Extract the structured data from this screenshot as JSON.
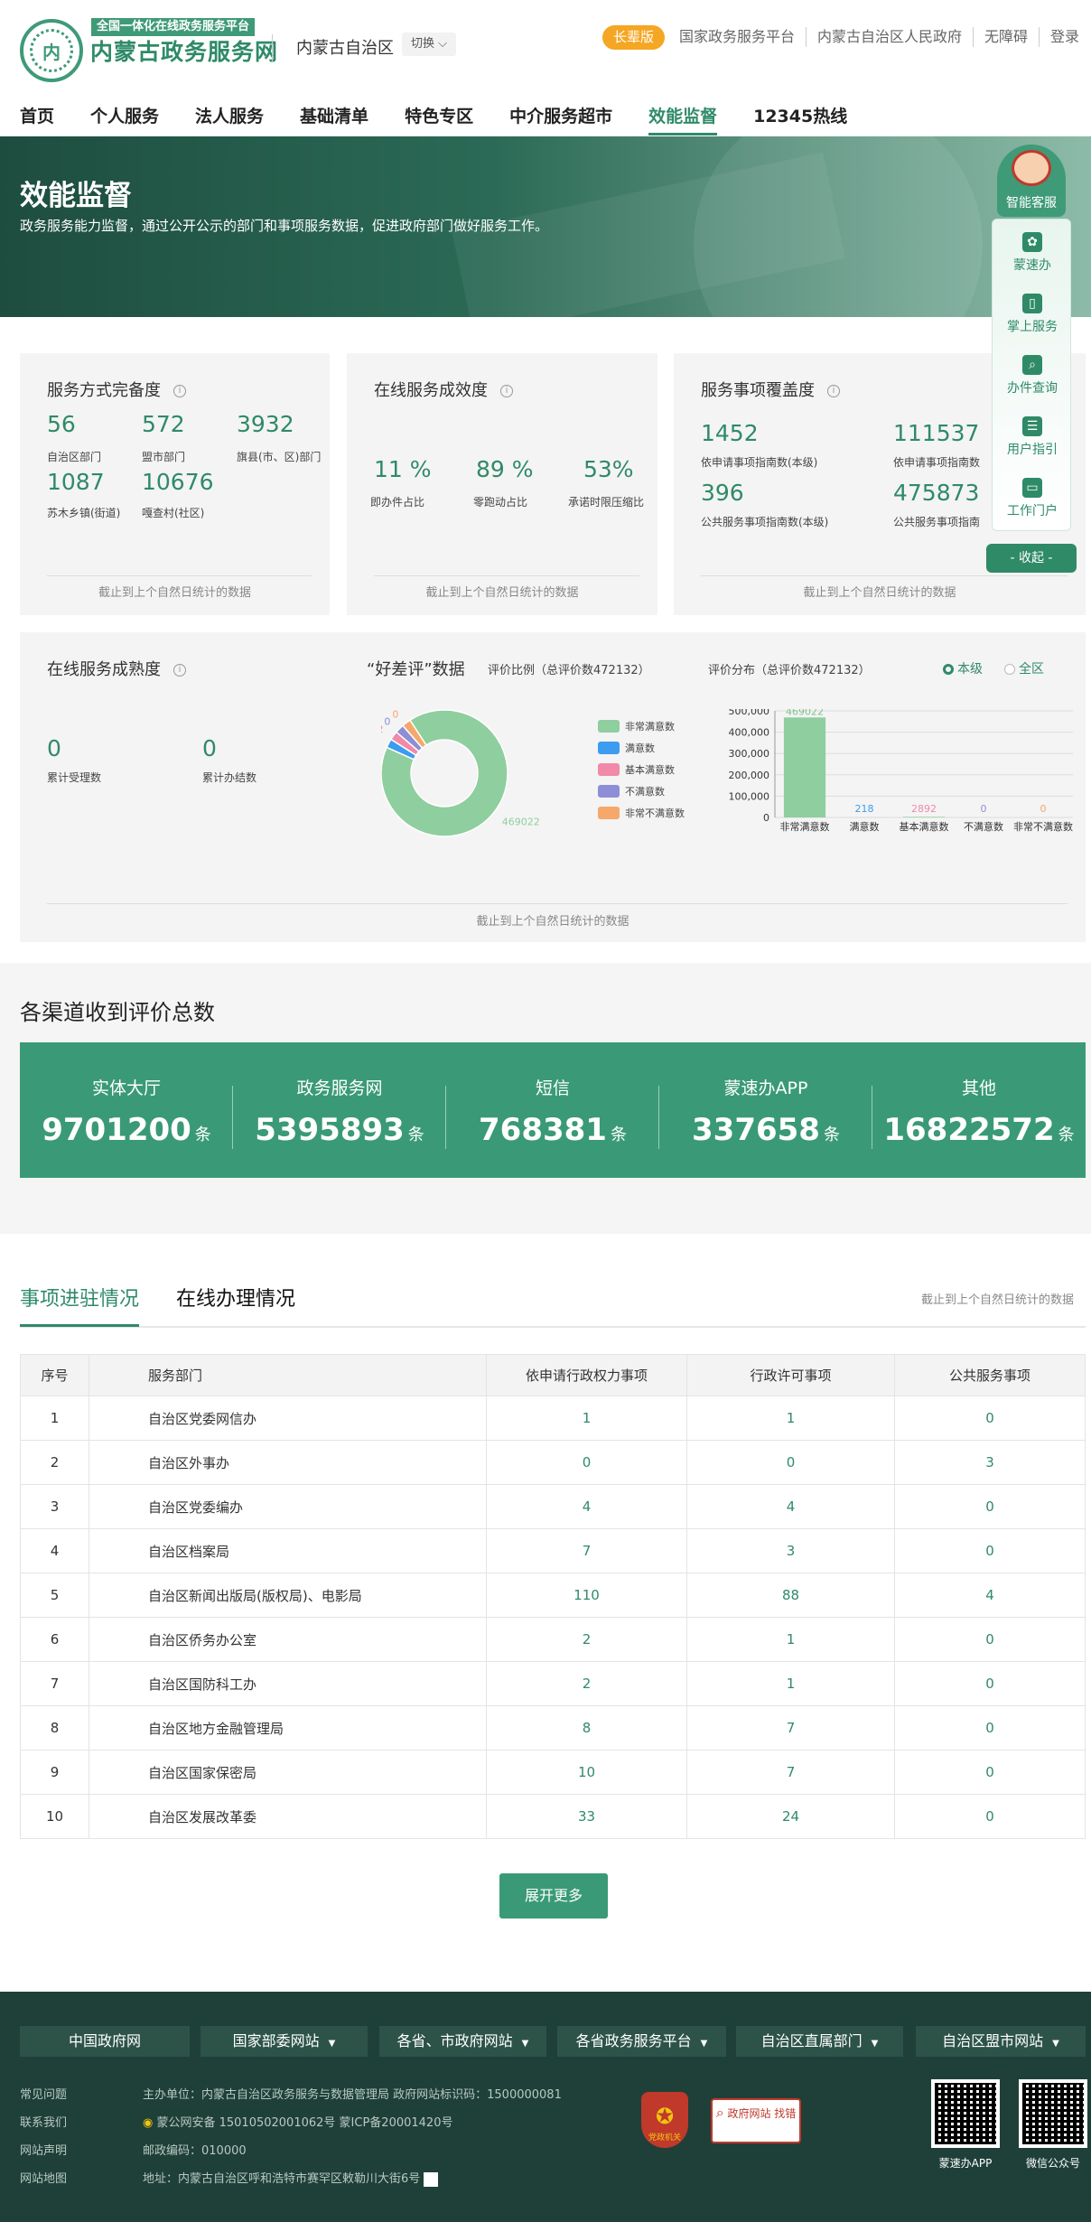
{
  "header": {
    "logo_tag": "全国一体化在线政务服务平台",
    "logo_title": "内蒙古政务服务网",
    "logo_circle_text": "内",
    "region": "内蒙古自治区",
    "switch_label": "切换",
    "elder_label": "长辈版",
    "top_links": [
      "国家政务服务平台",
      "内蒙古自治区人民政府",
      "无障碍",
      "登录"
    ]
  },
  "nav": [
    "首页",
    "个人服务",
    "法人服务",
    "基础清单",
    "特色专区",
    "中介服务超市",
    "效能监督",
    "12345热线"
  ],
  "nav_active": "效能监督",
  "banner": {
    "title": "效能监督",
    "desc": "政务服务能力监督，通过公开公示的部门和事项服务数据，促进政府部门做好服务工作。"
  },
  "cards": {
    "footer_note": "截止到上个自然日统计的数据",
    "completeness": {
      "title": "服务方式完备度",
      "items": [
        {
          "value": "56",
          "label": "自治区部门"
        },
        {
          "value": "572",
          "label": "盟市部门"
        },
        {
          "value": "3932",
          "label": "旗县(市、区)部门"
        },
        {
          "value": "1087",
          "label": "苏木乡镇(街道)"
        },
        {
          "value": "10676",
          "label": "嘎查村(社区)"
        }
      ]
    },
    "effectiveness": {
      "title": "在线服务成效度",
      "items": [
        {
          "value": "11 %",
          "label": "即办件占比"
        },
        {
          "value": "89 %",
          "label": "零跑动占比"
        },
        {
          "value": "53%",
          "label": "承诺时限压缩比"
        }
      ]
    },
    "coverage": {
      "title": "服务事项覆盖度",
      "items": [
        {
          "value": "1452",
          "label": "依申请事项指南数(本级)"
        },
        {
          "value": "111537",
          "label": "依申请事项指南数"
        },
        {
          "value": "396",
          "label": "公共服务事项指南数(本级)"
        },
        {
          "value": "475873",
          "label": "公共服务事项指南"
        }
      ]
    },
    "maturity": {
      "title": "在线服务成熟度",
      "items": [
        {
          "value": "0",
          "label": "累计受理数"
        },
        {
          "value": "0",
          "label": "累计办结数"
        }
      ]
    },
    "rating": {
      "title": "“好差评”数据",
      "ratio_label": "评价比例（总评价数472132）",
      "dist_label": "评价分布（总评价数472132）",
      "radio_local": "本级",
      "radio_all": "全区"
    }
  },
  "chart_data": [
    {
      "type": "pie",
      "labels": [
        "非常满意数",
        "满意数",
        "基本满意数",
        "不满意数",
        "非常不满意数"
      ],
      "values": [
        469022,
        218,
        2892,
        0,
        0
      ],
      "colors": [
        "#8fce9e",
        "#3b9cf0",
        "#f08aa8",
        "#8e8ed6",
        "#f5a86a"
      ]
    },
    {
      "type": "bar",
      "categories": [
        "非常满意数",
        "满意数",
        "基本满意数",
        "不满意数",
        "非常不满意数"
      ],
      "values": [
        469022,
        218,
        2892,
        0,
        0
      ],
      "label_colors": [
        "#7cc38d",
        "#3b9cf0",
        "#f08aa8",
        "#8e8ed6",
        "#f5a86a"
      ],
      "ylim": [
        0,
        500000
      ],
      "yticks": [
        "0",
        "100,000",
        "200,000",
        "300,000",
        "400,000",
        "500,000"
      ]
    }
  ],
  "channels": {
    "title": "各渠道收到评价总数",
    "unit": "条",
    "items": [
      {
        "label": "实体大厅",
        "value": "9701200"
      },
      {
        "label": "政务服务网",
        "value": "5395893"
      },
      {
        "label": "短信",
        "value": "768381"
      },
      {
        "label": "蒙速办APP",
        "value": "337658"
      },
      {
        "label": "其他",
        "value": "16822572"
      }
    ]
  },
  "tabs": {
    "active": "事项进驻情况",
    "other": "在线办理情况",
    "note": "截止到上个自然日统计的数据"
  },
  "table": {
    "headers": [
      "序号",
      "服务部门",
      "依申请行政权力事项",
      "行政许可事项",
      "公共服务事项"
    ],
    "rows": [
      [
        "1",
        "自治区党委网信办",
        "1",
        "1",
        "0"
      ],
      [
        "2",
        "自治区外事办",
        "0",
        "0",
        "3"
      ],
      [
        "3",
        "自治区党委编办",
        "4",
        "4",
        "0"
      ],
      [
        "4",
        "自治区档案局",
        "7",
        "3",
        "0"
      ],
      [
        "5",
        "自治区新闻出版局(版权局)、电影局",
        "110",
        "88",
        "4"
      ],
      [
        "6",
        "自治区侨务办公室",
        "2",
        "1",
        "0"
      ],
      [
        "7",
        "自治区国防科工办",
        "2",
        "1",
        "0"
      ],
      [
        "8",
        "自治区地方金融管理局",
        "8",
        "7",
        "0"
      ],
      [
        "9",
        "自治区国家保密局",
        "10",
        "7",
        "0"
      ],
      [
        "10",
        "自治区发展改革委",
        "33",
        "24",
        "0"
      ]
    ],
    "more_label": "展开更多"
  },
  "float": {
    "title": "智能客服",
    "items": [
      "蒙速办",
      "掌上服务",
      "办件查询",
      "用户指引",
      "工作门户"
    ],
    "collapse": "- 收起 -"
  },
  "footer": {
    "selects": [
      "中国政府网",
      "国家部委网站",
      "各省、市政府网站",
      "各省政务服务平台",
      "自治区直属部门",
      "自治区盟市网站"
    ],
    "links": [
      "常见问题",
      "联系我们",
      "网站声明",
      "网站地图"
    ],
    "info": [
      "主办单位：内蒙古自治区政务服务与数据管理局    政府网站标识码：1500000081",
      "蒙公网安备 15010502001062号      蒙ICP备20001420号",
      "邮政编码：010000",
      "地址：内蒙古自治区呼和浩特市赛罕区敕勒川大街6号"
    ],
    "badge_text": "党政机关",
    "error_box": "政府网站 找错",
    "qr_labels": [
      "蒙速办APP",
      "微信公众号"
    ]
  }
}
